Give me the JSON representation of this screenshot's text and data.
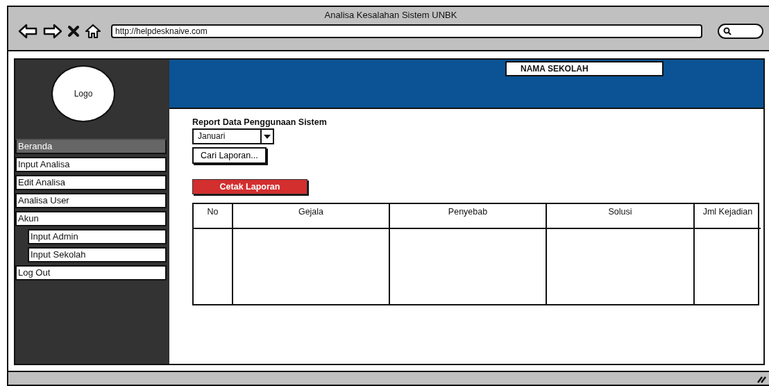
{
  "window": {
    "title": "Analisa Kesalahan Sistem UNBK",
    "url": "http://helpdesknaive.com"
  },
  "sidebar": {
    "logo": "Logo",
    "items": [
      {
        "label": "Beranda",
        "selected": true
      },
      {
        "label": "Input Analisa",
        "selected": false
      },
      {
        "label": "Edit Analisa",
        "selected": false
      },
      {
        "label": "Analisa User",
        "selected": false
      },
      {
        "label": "Akun",
        "selected": false,
        "children": [
          {
            "label": "Input Admin",
            "selected": false
          },
          {
            "label": "Input Sekolah",
            "selected": false
          }
        ]
      },
      {
        "label": "Log Out",
        "selected": false
      }
    ]
  },
  "header": {
    "school_name": "NAMA SEKOLAH"
  },
  "report": {
    "title": "Report Data Penggunaan Sistem",
    "month_select": {
      "value": "Januari"
    },
    "search_button": "Cari Laporan...",
    "print_button": "Cetak Laporan"
  },
  "table": {
    "columns": [
      "No",
      "Gejala",
      "Penyebab",
      "Solusi",
      "Jml Kejadian"
    ]
  }
}
